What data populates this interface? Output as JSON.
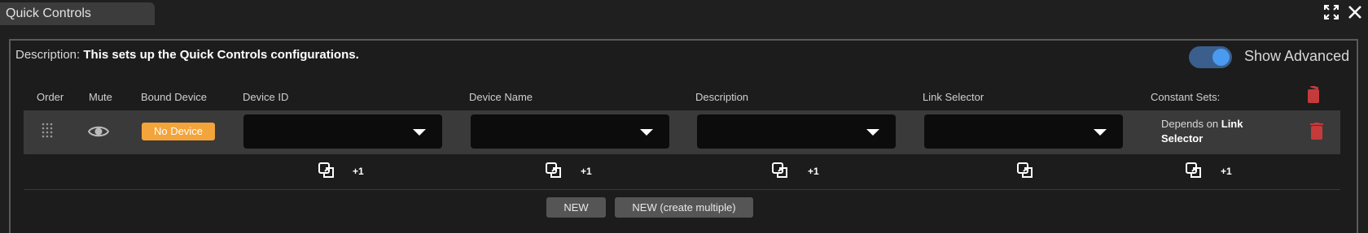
{
  "window": {
    "tab_title": "Quick Controls"
  },
  "description": {
    "label": "Description:",
    "text": "This sets up the Quick Controls configurations."
  },
  "advanced": {
    "label": "Show Advanced",
    "enabled": true
  },
  "columns": {
    "order": "Order",
    "mute": "Mute",
    "bound_device": "Bound Device",
    "device_id": "Device ID",
    "device_name": "Device Name",
    "description": "Description",
    "link_selector": "Link Selector",
    "constant_sets": "Constant Sets:"
  },
  "row": {
    "bound_device": "No Device",
    "device_id": "",
    "device_name": "",
    "description": "",
    "link_selector": "",
    "constant_sets_prefix": "Depends on",
    "constant_sets_link": "Link",
    "constant_sets_suffix": "Selector"
  },
  "footer": {
    "plus_one": "+1"
  },
  "buttons": {
    "new": "NEW",
    "new_multiple": "NEW (create multiple)"
  },
  "colors": {
    "badge": "#f3a43b",
    "trash": "#c53a3a",
    "toggle_knob": "#4a9bf0",
    "toggle_track": "#3a5f8c"
  },
  "icons": [
    "expand-icon",
    "close-icon",
    "drag-handle-icon",
    "eye-icon",
    "trash-icon",
    "copy-icon",
    "chevron-down-icon"
  ]
}
